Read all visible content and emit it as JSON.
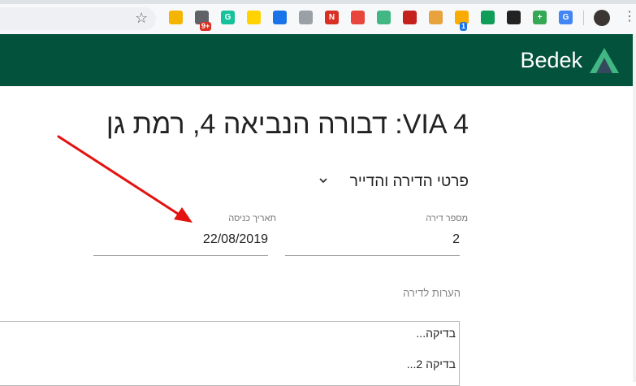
{
  "browser": {
    "extensions": [
      {
        "icon": "google-drive-icon",
        "color": "#f4b400",
        "text": ""
      },
      {
        "icon": "tracker-icon",
        "color": "#5f6368",
        "text": "",
        "badge": "9+",
        "badge_color": "#d93025"
      },
      {
        "icon": "grammarly-icon",
        "color": "#15c39a",
        "text": "G"
      },
      {
        "icon": "norton-icon",
        "color": "#ffd200",
        "text": ""
      },
      {
        "icon": "translate-bubble-icon",
        "color": "#1a73e8",
        "text": ""
      },
      {
        "icon": "reader-icon",
        "color": "#9aa0a6",
        "text": ""
      },
      {
        "icon": "n-extension-icon",
        "color": "#d93025",
        "text": "N"
      },
      {
        "icon": "shield-icon",
        "color": "#e8453c",
        "text": ""
      },
      {
        "icon": "vue-devtools-icon",
        "color": "#41b883",
        "text": ""
      },
      {
        "icon": "screenshot-icon",
        "color": "#c5221f",
        "text": ""
      },
      {
        "icon": "palette-icon",
        "color": "#e8a33d",
        "text": ""
      },
      {
        "icon": "notes-icon",
        "color": "#f9ab00",
        "text": "",
        "badge": "1",
        "badge_color": "#1a73e8"
      },
      {
        "icon": "expand-icon",
        "color": "#0f9d58",
        "text": ""
      },
      {
        "icon": "tripadvisor-icon",
        "color": "#222222",
        "text": ""
      },
      {
        "icon": "plus-circle-icon",
        "color": "#34a853",
        "text": "+"
      },
      {
        "icon": "google-translate-icon",
        "color": "#4285f4",
        "text": "G"
      }
    ]
  },
  "header": {
    "brand": "Bedek"
  },
  "page": {
    "title": "VIA 4: דבורה הנביאה 4, רמת גן",
    "section_title": "פרטי הדירה והדייר",
    "fields": {
      "apartment_number": {
        "label": "מספר דירה",
        "value": "2"
      },
      "entry_date": {
        "label": "תאריך כניסה",
        "value": "22/08/2019"
      }
    },
    "notes": {
      "label": "הערות לדירה",
      "lines": [
        "בדיקה...",
        "בדיקה 2..."
      ]
    }
  },
  "colors": {
    "appbar": "#03523b",
    "logo_light": "#41b883",
    "logo_dark": "#35495e",
    "annotation_arrow": "#e3130f"
  }
}
